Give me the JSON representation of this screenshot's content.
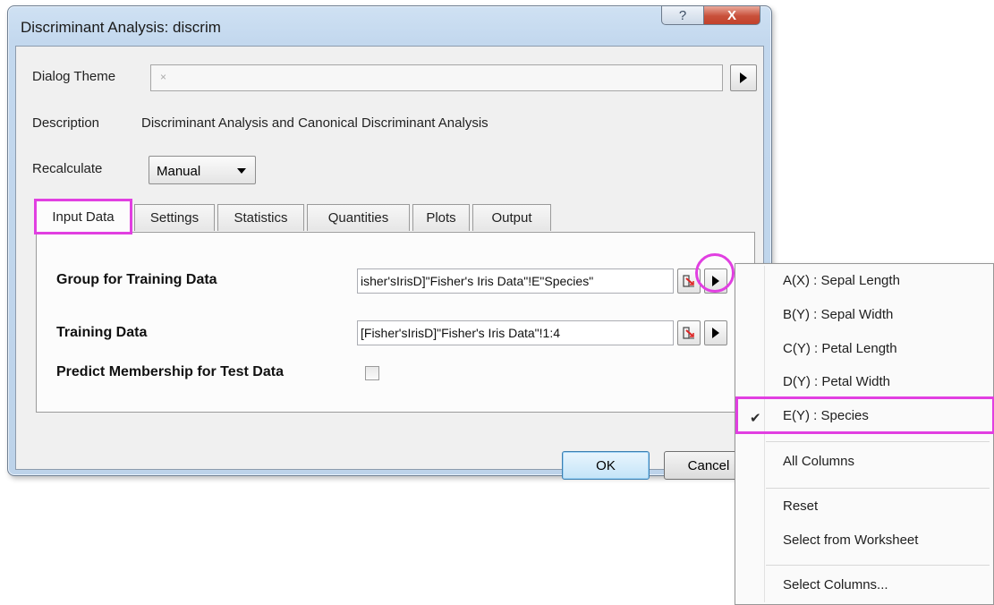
{
  "window": {
    "title": "Discriminant Analysis: discrim",
    "help_glyph": "?",
    "close_glyph": "X"
  },
  "theme": {
    "label": "Dialog Theme",
    "value": "×"
  },
  "description": {
    "label": "Description",
    "value": "Discriminant Analysis and Canonical Discriminant Analysis"
  },
  "recalculate": {
    "label": "Recalculate",
    "value": "Manual"
  },
  "tabs": [
    {
      "label": "Input Data",
      "active": true
    },
    {
      "label": "Settings"
    },
    {
      "label": "Statistics"
    },
    {
      "label": "Quantities"
    },
    {
      "label": "Plots"
    },
    {
      "label": "Output"
    }
  ],
  "input_data": {
    "group_label": "Group for Training Data",
    "group_value": "isher'sIrisD]\"Fisher's Iris Data\"!E\"Species\"",
    "training_label": "Training Data",
    "training_value": "[Fisher'sIrisD]\"Fisher's Iris Data\"!1:4",
    "predict_label": "Predict Membership for Test Data",
    "predict_checked": false
  },
  "buttons": {
    "ok": "OK",
    "cancel": "Cancel"
  },
  "menu": {
    "items": [
      "A(X) : Sepal Length",
      "B(Y) : Sepal Width",
      "C(Y) : Petal Length",
      "D(Y) : Petal Width",
      "E(Y) : Species",
      "All Columns",
      "Reset",
      "Select from Worksheet",
      "Select Columns..."
    ],
    "checked_item": "E(Y) : Species",
    "check_glyph": "✔"
  },
  "colors": {
    "highlight": "#e13fe1",
    "titlebar": "#c3d8ee",
    "close_button": "#c8503a"
  }
}
